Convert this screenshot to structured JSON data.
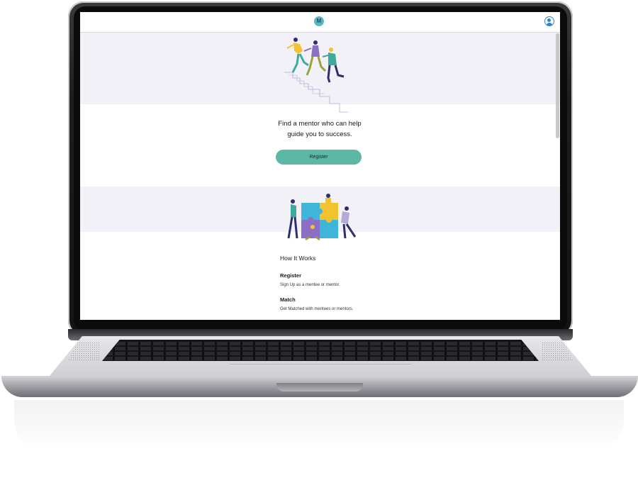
{
  "app": {
    "logo_letter": "M",
    "icons": {
      "logo": "m-logo-icon",
      "profile": "user-profile-icon"
    }
  },
  "hero": {
    "headline_line1": "Find a mentor who can help",
    "headline_line2": "guide you to success.",
    "register_label": "Register"
  },
  "how_it_works": {
    "title": "How It Works",
    "steps": [
      {
        "title": "Register",
        "description": "Sign Up as a mentee or mentor."
      },
      {
        "title": "Match",
        "description": "Get Matched with mentees or mentors."
      }
    ]
  },
  "colors": {
    "accent": "#5cb7a5",
    "band": "#f3f1f8",
    "logo": "#5fb8bd",
    "profile": "#2f86c6"
  }
}
